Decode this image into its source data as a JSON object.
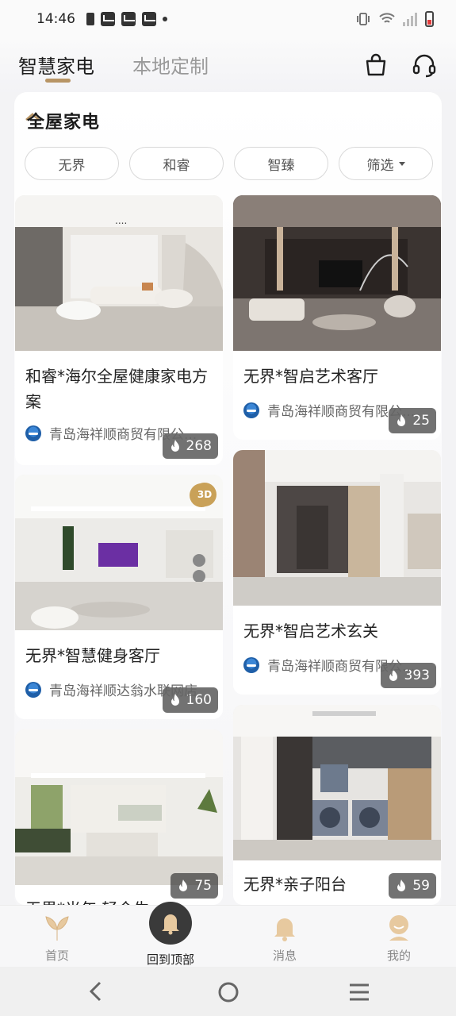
{
  "status_bar": {
    "time": "14:46",
    "icons": [
      "sim-icon",
      "mail-icon",
      "mail-icon",
      "mail-icon",
      "dot-icon"
    ],
    "right_icons": [
      "vibrate-icon",
      "wifi-icon",
      "signal-icon",
      "battery-icon"
    ]
  },
  "header": {
    "tabs": [
      {
        "label": "智慧家电",
        "active": true
      },
      {
        "label": "本地定制",
        "active": false
      }
    ],
    "icons": [
      "shopping-bag-icon",
      "headset-icon"
    ],
    "accent_color": "#b89565"
  },
  "section": {
    "title": "全屋家电"
  },
  "filters": [
    {
      "label": "无界"
    },
    {
      "label": "和睿"
    },
    {
      "label": "智臻"
    },
    {
      "label": "筛选"
    }
  ],
  "cards": [
    {
      "title": "和睿*海尔全屋健康家电方案",
      "count": "268",
      "seller": "青岛海祥顺商贸有限公..."
    },
    {
      "title": "无界*智启艺术客厅",
      "count": "25",
      "seller": "青岛海祥顺商贸有限公..."
    },
    {
      "title": "无界*智慧健身客厅",
      "count": "160",
      "seller": "青岛海祥顺达翁水联网店",
      "badge_3d": "3D"
    },
    {
      "title": "无界*智启艺术玄关",
      "count": "393",
      "seller": "青岛海祥顺商贸有限公..."
    },
    {
      "title": "无界*光年·轻会生",
      "count": "75"
    },
    {
      "title": "无界*亲子阳台",
      "count": "59"
    }
  ],
  "bottom_nav": [
    {
      "label": "首页",
      "icon": "home-leaf-icon"
    },
    {
      "label": "回到顶部",
      "icon": "back-to-top-icon"
    },
    {
      "label": "消息",
      "icon": "bell-icon"
    },
    {
      "label": "我的",
      "icon": "profile-icon"
    }
  ]
}
